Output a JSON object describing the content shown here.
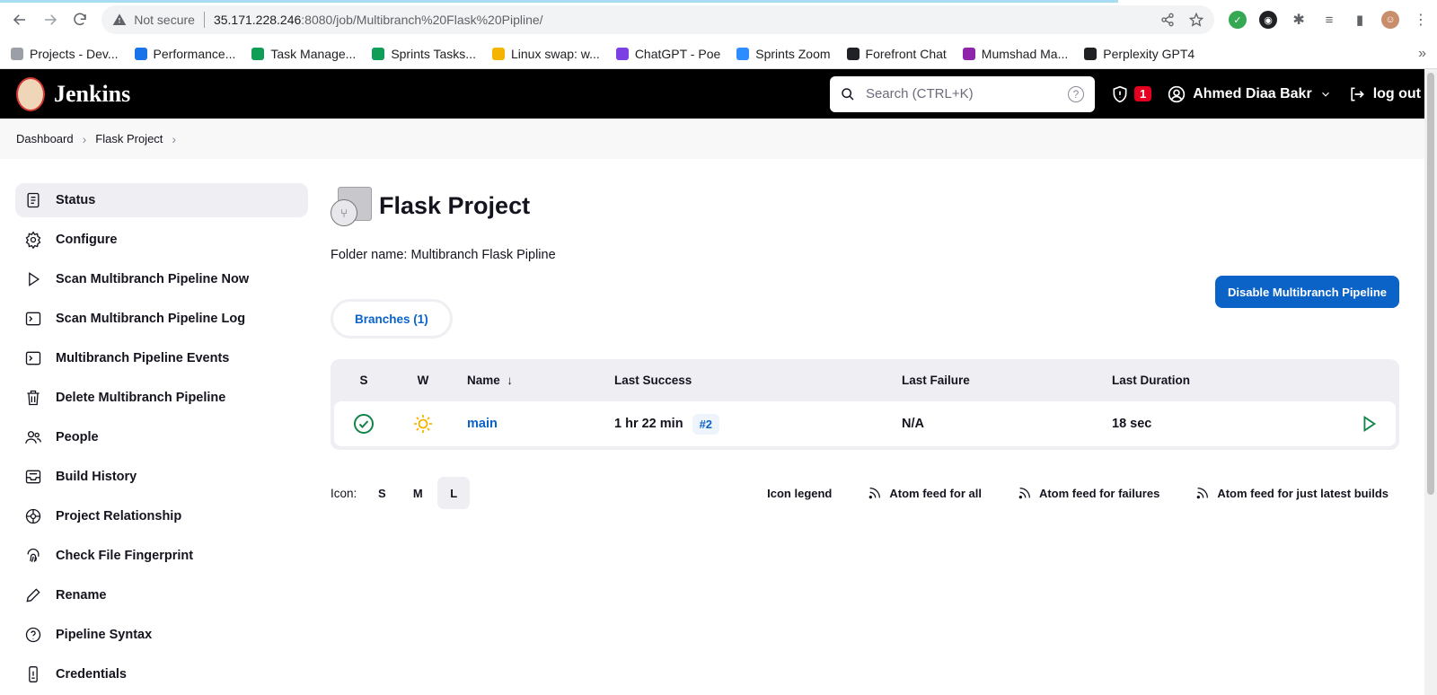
{
  "browser": {
    "not_secure_label": "Not secure",
    "url_host": "35.171.228.246",
    "url_rest": ":8080/job/Multibranch%20Flask%20Pipline/",
    "bookmarks": [
      {
        "label": "Projects - Dev...",
        "color": "#9aa0a6"
      },
      {
        "label": "Performance...",
        "color": "#1a73e8"
      },
      {
        "label": "Task Manage...",
        "color": "#0f9d58"
      },
      {
        "label": "Sprints Tasks...",
        "color": "#0f9d58"
      },
      {
        "label": "Linux swap: w...",
        "color": "#f4b400"
      },
      {
        "label": "ChatGPT - Poe",
        "color": "#7b3fe4"
      },
      {
        "label": "Sprints Zoom",
        "color": "#2d8cff"
      },
      {
        "label": "Forefront Chat",
        "color": "#202124"
      },
      {
        "label": "Mumshad Ma...",
        "color": "#8e24aa"
      },
      {
        "label": "Perplexity GPT4",
        "color": "#202124"
      }
    ],
    "more_bookmarks": "»"
  },
  "header": {
    "app_name": "Jenkins",
    "search_placeholder": "Search (CTRL+K)",
    "help_glyph": "?",
    "security_count": "1",
    "user_name": "Ahmed Diaa Bakr",
    "logout_label": "log out"
  },
  "breadcrumb": {
    "items": [
      "Dashboard",
      "Flask Project"
    ]
  },
  "sidebar": {
    "items": [
      {
        "label": "Status",
        "icon": "status-icon"
      },
      {
        "label": "Configure",
        "icon": "gear-icon"
      },
      {
        "label": "Scan Multibranch Pipeline Now",
        "icon": "play-icon"
      },
      {
        "label": "Scan Multibranch Pipeline Log",
        "icon": "terminal-icon"
      },
      {
        "label": "Multibranch Pipeline Events",
        "icon": "terminal-icon"
      },
      {
        "label": "Delete Multibranch Pipeline",
        "icon": "trash-icon"
      },
      {
        "label": "People",
        "icon": "people-icon"
      },
      {
        "label": "Build History",
        "icon": "inbox-icon"
      },
      {
        "label": "Project Relationship",
        "icon": "relationship-icon"
      },
      {
        "label": "Check File Fingerprint",
        "icon": "fingerprint-icon"
      },
      {
        "label": "Rename",
        "icon": "pencil-icon"
      },
      {
        "label": "Pipeline Syntax",
        "icon": "help-circle-icon"
      },
      {
        "label": "Credentials",
        "icon": "phone-key-icon"
      }
    ]
  },
  "main": {
    "title": "Flask Project",
    "folder_name": "Folder name: Multibranch Flask Pipline",
    "disable_button": "Disable Multibranch Pipeline",
    "tab_label": "Branches (1)",
    "table": {
      "headers": {
        "s": "S",
        "w": "W",
        "name": "Name",
        "sort_arrow": "↓",
        "last_success": "Last Success",
        "last_failure": "Last Failure",
        "last_duration": "Last Duration"
      },
      "rows": [
        {
          "status": "success",
          "weather": "sunny",
          "name": "main",
          "last_success": "1 hr 22 min",
          "build": "#2",
          "last_failure": "N/A",
          "last_duration": "18 sec"
        }
      ]
    },
    "icon_size": {
      "label": "Icon:",
      "options": [
        "S",
        "M",
        "L"
      ],
      "selected": "L"
    },
    "legend_links": {
      "icon_legend": "Icon legend",
      "feed_all": "Atom feed for all",
      "feed_failures": "Atom feed for failures",
      "feed_latest": "Atom feed for just latest builds"
    }
  },
  "colors": {
    "accent": "#0b63c8",
    "success": "#138347",
    "weather": "#f4b400",
    "alert": "#e6001f"
  }
}
